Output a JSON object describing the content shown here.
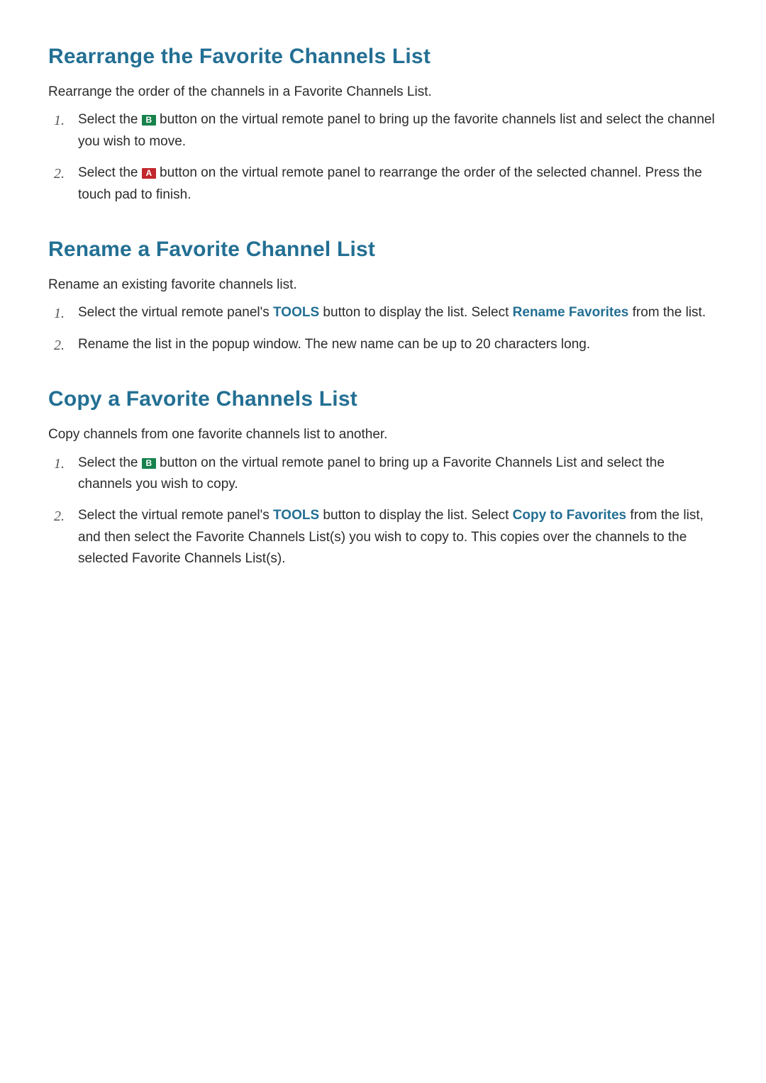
{
  "sections": [
    {
      "heading": "Rearrange the Favorite Channels List",
      "intro": "Rearrange the order of the channels in a Favorite Channels List.",
      "steps": [
        {
          "parts": [
            {
              "t": "text",
              "v": "Select the "
            },
            {
              "t": "btn",
              "label": "B",
              "cls": "btn-b"
            },
            {
              "t": "text",
              "v": " button on the virtual remote panel to bring up the favorite channels list and select the channel you wish to move."
            }
          ]
        },
        {
          "parts": [
            {
              "t": "text",
              "v": "Select the "
            },
            {
              "t": "btn",
              "label": "A",
              "cls": "btn-a"
            },
            {
              "t": "text",
              "v": " button on the virtual remote panel to rearrange the order of the selected channel. Press the touch pad to finish."
            }
          ]
        }
      ]
    },
    {
      "heading": "Rename a Favorite Channel List",
      "intro": "Rename an existing favorite channels list.",
      "steps": [
        {
          "parts": [
            {
              "t": "text",
              "v": "Select the virtual remote panel's "
            },
            {
              "t": "kw",
              "v": "TOOLS"
            },
            {
              "t": "text",
              "v": " button to display the list. Select "
            },
            {
              "t": "kw",
              "v": "Rename Favorites"
            },
            {
              "t": "text",
              "v": " from the list."
            }
          ]
        },
        {
          "parts": [
            {
              "t": "text",
              "v": "Rename the list in the popup window. The new name can be up to 20 characters long."
            }
          ]
        }
      ]
    },
    {
      "heading": "Copy a Favorite Channels List",
      "intro": "Copy channels from one favorite channels list to another.",
      "steps": [
        {
          "parts": [
            {
              "t": "text",
              "v": "Select the "
            },
            {
              "t": "btn",
              "label": "B",
              "cls": "btn-b"
            },
            {
              "t": "text",
              "v": " button on the virtual remote panel to bring up a Favorite Channels List and select the channels you wish to copy."
            }
          ]
        },
        {
          "parts": [
            {
              "t": "text",
              "v": "Select the virtual remote panel's "
            },
            {
              "t": "kw",
              "v": "TOOLS"
            },
            {
              "t": "text",
              "v": " button to display the list. Select "
            },
            {
              "t": "kw",
              "v": "Copy to Favorites"
            },
            {
              "t": "text",
              "v": " from the list, and then select the Favorite Channels List(s) you wish to copy to. This copies over the channels to the selected Favorite Channels List(s)."
            }
          ]
        }
      ]
    }
  ],
  "icons": {
    "btn-b": "remote-button-b-icon",
    "btn-a": "remote-button-a-icon"
  }
}
